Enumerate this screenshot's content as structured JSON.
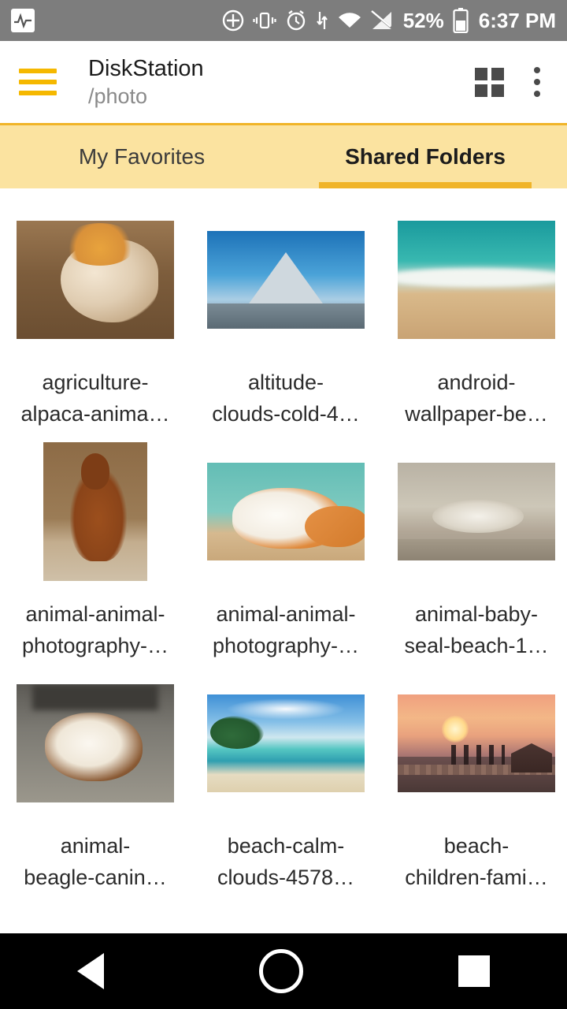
{
  "statusbar": {
    "icons": [
      "activity-pulse-icon",
      "cast-icon",
      "vibrate-icon",
      "alarm-icon",
      "sync-icon",
      "wifi-icon",
      "signal-off-icon"
    ],
    "battery_percent": "52%",
    "time": "6:37 PM"
  },
  "appbar": {
    "menu_icon": "hamburger-menu-icon",
    "title": "DiskStation",
    "subtitle": "/photo",
    "view_toggle_icon": "grid-view-icon",
    "overflow_icon": "more-options-icon"
  },
  "tabs": [
    {
      "label": "My Favorites",
      "active": false
    },
    {
      "label": "Shared Folders",
      "active": true
    }
  ],
  "grid": {
    "items": [
      {
        "thumb": "alpaca-head-photo",
        "shape": "wide",
        "line1": "agriculture-",
        "line2": "alpaca-anima…"
      },
      {
        "thumb": "mountain-photo",
        "shape": "short",
        "line1": "altitude-",
        "line2": "clouds-cold-4…"
      },
      {
        "thumb": "beach-aerial-photo",
        "shape": "wide",
        "line1": "android-",
        "line2": "wallpaper-be…"
      },
      {
        "thumb": "alpaca-standing-photo",
        "shape": "tall",
        "line1": "animal-animal-",
        "line2": "photography-…"
      },
      {
        "thumb": "cat-photo",
        "shape": "short",
        "line1": "animal-animal-",
        "line2": "photography-…"
      },
      {
        "thumb": "baby-seal-photo",
        "shape": "short",
        "line1": "animal-baby-",
        "line2": "seal-beach-1…"
      },
      {
        "thumb": "beagle-puppy-photo",
        "shape": "wide",
        "line1": "animal-",
        "line2": "beagle-canin…"
      },
      {
        "thumb": "tropical-beach-photo",
        "shape": "short",
        "line1": "beach-calm-",
        "line2": "clouds-4578…"
      },
      {
        "thumb": "sunset-pier-photo",
        "shape": "short",
        "line1": "beach-",
        "line2": "children-fami…"
      }
    ]
  },
  "navbar": {
    "back": "back-nav-icon",
    "home": "home-nav-icon",
    "recents": "recents-nav-icon"
  },
  "colors": {
    "accent": "#f0b429",
    "tabbar_bg": "#fbe3a0",
    "statusbar_bg": "#7d7d7d",
    "navbar_bg": "#000000"
  }
}
